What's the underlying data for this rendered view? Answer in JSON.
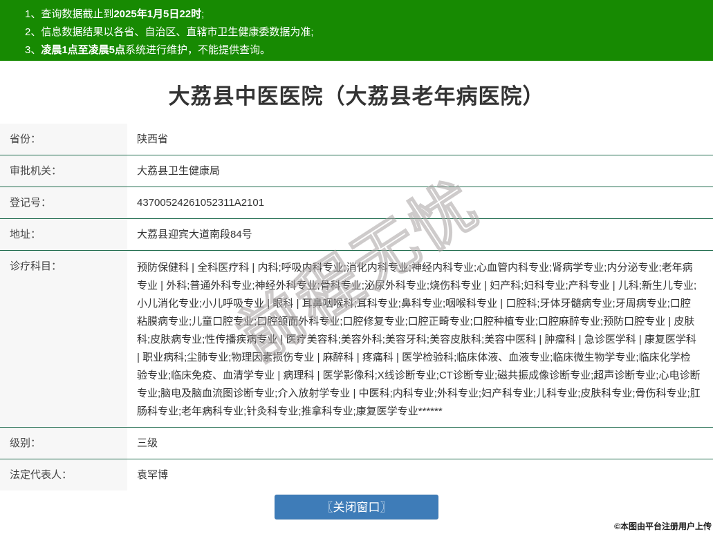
{
  "colors": {
    "header_green": "#178a02",
    "divider_green": "#1f6b4d",
    "label_bg": "#f7f7f7",
    "button_blue": "#3e7cb8",
    "watermark_gray": "#a5a0a0"
  },
  "notice": {
    "l1_pre": "1、查询数据截止到",
    "l1_bold": "2025年1月5日22时",
    "l1_post": ";",
    "l2": "2、信息数据结果以各省、自治区、直辖市卫生健康委数据为准;",
    "l3_pre": "3、",
    "l3_bold": "凌晨1点至凌晨5点",
    "l3_post": "系统进行维护，不能提供查询。"
  },
  "title": "大荔县中医医院（大荔县老年病医院）",
  "table": {
    "rows": [
      {
        "label": "省份：",
        "value": "陕西省"
      },
      {
        "label": "审批机关：",
        "value": "大荔县卫生健康局"
      },
      {
        "label": "登记号：",
        "value": "43700524261052311A2101"
      },
      {
        "label": "地址：",
        "value": "大荔县迎宾大道南段84号"
      },
      {
        "label": "诊疗科目：",
        "value": "预防保健科 | 全科医疗科 | 内科;呼吸内科专业;消化内科专业;神经内科专业;心血管内科专业;肾病学专业;内分泌专业;老年病专业 | 外科;普通外科专业;神经外科专业;骨科专业;泌尿外科专业;烧伤科专业 | 妇产科;妇科专业;产科专业 | 儿科;新生儿专业;小儿消化专业;小儿呼吸专业 | 眼科 | 耳鼻咽喉科;耳科专业;鼻科专业;咽喉科专业 | 口腔科;牙体牙髓病专业;牙周病专业;口腔粘膜病专业;儿童口腔专业;口腔颌面外科专业;口腔修复专业;口腔正畸专业;口腔种植专业;口腔麻醉专业;预防口腔专业 | 皮肤科;皮肤病专业;性传播疾病专业 | 医疗美容科;美容外科;美容牙科;美容皮肤科;美容中医科 | 肿瘤科 | 急诊医学科 | 康复医学科 | 职业病科;尘肺专业;物理因素损伤专业 | 麻醉科 | 疼痛科 | 医学检验科;临床体液、血液专业;临床微生物学专业;临床化学检验专业;临床免疫、血清学专业 | 病理科 | 医学影像科;X线诊断专业;CT诊断专业;磁共振成像诊断专业;超声诊断专业;心电诊断专业;脑电及脑血流图诊断专业;介入放射学专业 | 中医科;内科专业;外科专业;妇产科专业;儿科专业;皮肤科专业;骨伤科专业;肛肠科专业;老年病科专业;针灸科专业;推拿科专业;康复医学专业******"
      },
      {
        "label": "级别：",
        "value": "三级"
      },
      {
        "label": "法定代表人：",
        "value": "袁罕博"
      }
    ]
  },
  "close_button": {
    "label": "〖关闭窗口〗"
  },
  "watermark": {
    "diagonal": "前程无忧",
    "caption": "©本图由平台注册用户上传"
  }
}
